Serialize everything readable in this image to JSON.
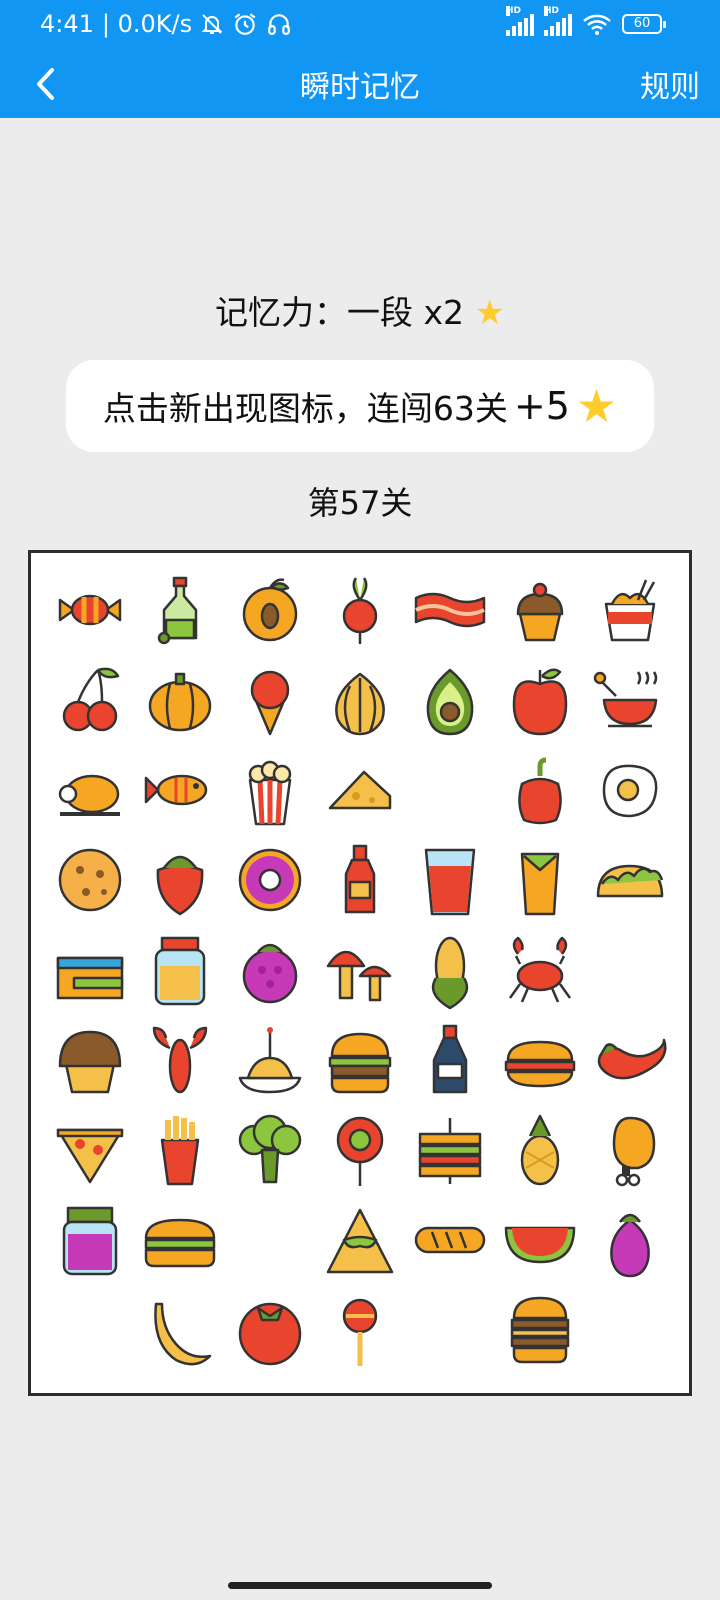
{
  "status": {
    "time": "4:41",
    "speed": "| 0.0K/s",
    "signal1": "HD",
    "signal2": "HD",
    "battery": "60"
  },
  "header": {
    "title": "瞬时记忆",
    "rules": "规则"
  },
  "memory": {
    "label": "记忆力：一段 x2",
    "star": "★"
  },
  "tip": {
    "text": "点击新出现图标，连闯63关",
    "bonus": "+5",
    "star": "★"
  },
  "level": "第57关",
  "board": {
    "rows": [
      [
        "candy",
        "oil-bottle",
        "apricot",
        "radish",
        "bacon",
        "cupcake",
        "noodles"
      ],
      [
        "cherries",
        "pumpkin",
        "ice-cream-cone",
        "onion",
        "avocado",
        "apple",
        "soup-bowl"
      ],
      [
        "roast-chicken",
        "fish",
        "popcorn",
        "cheese",
        "",
        "bell-pepper",
        "fried-egg"
      ],
      [
        "cookie",
        "strawberry",
        "donut",
        "ketchup",
        "juice-glass",
        "burrito",
        "taco"
      ],
      [
        "cake-slice",
        "honey-jar",
        "raspberry",
        "mushrooms",
        "corn",
        "crab",
        ""
      ],
      [
        "muffin",
        "lobster",
        "spaghetti",
        "burger",
        "soy-sauce",
        "hot-dog",
        "chili-pepper"
      ],
      [
        "pizza-slice",
        "french-fries",
        "broccoli",
        "lollipop",
        "sandwich",
        "pineapple",
        "chicken-leg"
      ],
      [
        "jam-jar",
        "sub-sandwich",
        "",
        "nacho",
        "baguette",
        "watermelon",
        "eggplant"
      ],
      [
        "",
        "banana",
        "tomato",
        "round-lollipop",
        "",
        "double-burger",
        ""
      ]
    ]
  }
}
